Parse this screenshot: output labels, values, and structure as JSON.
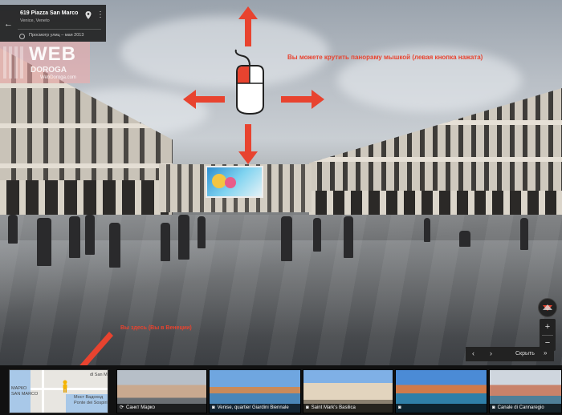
{
  "place": {
    "title": "619 Piazza San Marco",
    "subtitle": "Venice, Veneto",
    "history": "Просмотр улиц – мая 2013"
  },
  "watermark": {
    "brand": "WEB",
    "sub": "DOROGA",
    "url": "WebDoroga.com"
  },
  "annotations": {
    "drag_hint": "Вы можете крутить панораму мышкой (левая кнопка нажата)",
    "map_hint": "Вы здесь (Вы в Венеции)",
    "arrow_color": "#e8432f"
  },
  "controls": {
    "zoom_in": "+",
    "zoom_out": "−",
    "prev": "‹",
    "next": "›",
    "hide_label": "Скрыть",
    "hide_chevron": "»"
  },
  "minimap": {
    "labels": [
      "МАРКО",
      "SAN MARCO",
      "Мост Вадоход",
      "Ponte dei Sospiri",
      "dl San M"
    ]
  },
  "thumbnails": [
    {
      "caption": "Санкт Марко",
      "icon": "pano-360-icon"
    },
    {
      "caption": "Venise, quartier Giardini Biennale",
      "icon": "camera-icon"
    },
    {
      "caption": "Saint Mark's Basilica",
      "icon": "camera-icon"
    },
    {
      "caption": "",
      "icon": "camera-icon"
    },
    {
      "caption": "Canale di Cannaregio",
      "icon": "camera-icon"
    }
  ]
}
